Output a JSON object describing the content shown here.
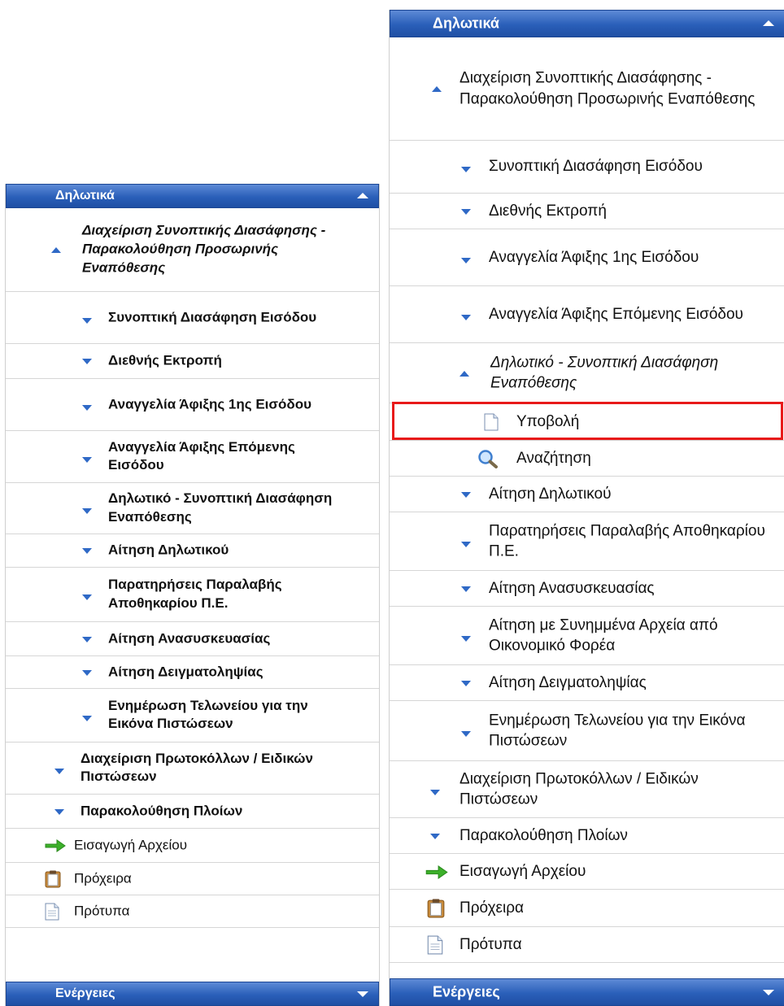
{
  "left": {
    "header": "Δηλωτικά",
    "group": "Διαχείριση Συνοπτικής Διασάφησης - Παρακολούθηση Προσωρινής Εναπόθεσης",
    "items": [
      "Συνοπτική Διασάφηση Εισόδου",
      "Διεθνής Εκτροπή",
      "Αναγγελία Άφιξης 1ης Εισόδου",
      "Αναγγελία Άφιξης Επόμενης Εισόδου",
      "Δηλωτικό - Συνοπτική Διασάφηση Εναπόθεσης",
      "Αίτηση Δηλωτικού",
      "Παρατηρήσεις Παραλαβής Αποθηκαρίου Π.Ε.",
      "Αίτηση Ανασυσκευασίας",
      "Αίτηση Δειγματοληψίας",
      "Ενημέρωση Τελωνείου για την Εικόνα Πιστώσεων"
    ],
    "group2": "Διαχείριση Πρωτοκόλλων / Ειδικών Πιστώσεων",
    "group3": "Παρακολούθηση Πλοίων",
    "import": "Εισαγωγή Αρχείου",
    "drafts": "Πρόχειρα",
    "templates": "Πρότυπα",
    "footer": "Ενέργειες"
  },
  "right": {
    "header": "Δηλωτικά",
    "group": "Διαχείριση Συνοπτικής Διασάφησης - Παρακολούθηση Προσωρινής Εναπόθεσης",
    "items": [
      "Συνοπτική Διασάφηση Εισόδου",
      "Διεθνής Εκτροπή",
      "Αναγγελία Άφιξης 1ης Εισόδου",
      "Αναγγελία Άφιξης Επόμενης Εισόδου",
      "Δηλωτικό - Συνοπτική Διασάφηση Εναπόθεσης",
      "Αίτηση Δηλωτικού",
      "Παρατηρήσεις Παραλαβής Αποθηκαρίου Π.Ε.",
      "Αίτηση Ανασυσκευασίας",
      "Αίτηση με Συνημμένα Αρχεία από Οικονομικό Φορέα",
      "Αίτηση Δειγματοληψίας",
      "Ενημέρωση Τελωνείου για την Εικόνα Πιστώσεων"
    ],
    "sub": {
      "submit": "Υποβολή",
      "search": "Αναζήτηση"
    },
    "group2": "Διαχείριση Πρωτοκόλλων / Ειδικών Πιστώσεων",
    "group3": "Παρακολούθηση Πλοίων",
    "import": "Εισαγωγή Αρχείου",
    "drafts": "Πρόχειρα",
    "templates": "Πρότυπα",
    "footer": "Ενέργειες"
  },
  "colors": {
    "header": "#2a5fb9",
    "arrow": "#2f69c6",
    "highlight": "#e81a1a",
    "import_arrow": "#3cb02a"
  }
}
